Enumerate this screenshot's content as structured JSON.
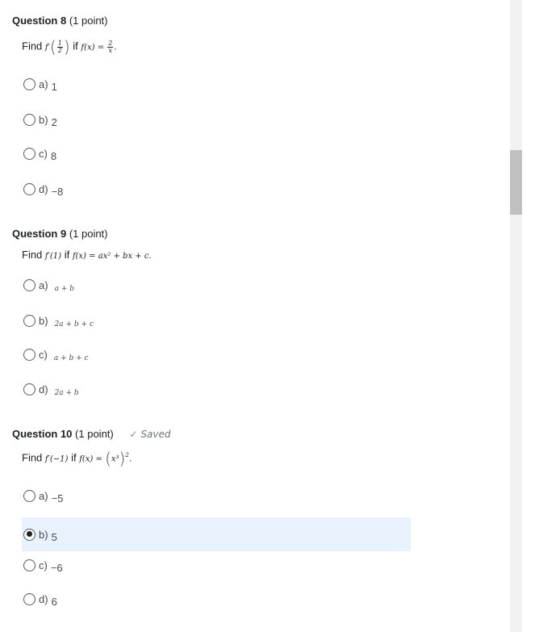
{
  "questions": [
    {
      "title": "Question 8",
      "points": "(1 point)",
      "prompt": {
        "find": "Find",
        "fprime": "f′",
        "frac_num": "1",
        "frac_den": "2",
        "if": "if",
        "fx": "f(x) = ",
        "rhs_num": "2",
        "rhs_den": "x",
        "end": "."
      },
      "options": [
        {
          "letter": "a)",
          "value": "1"
        },
        {
          "letter": "b)",
          "value": "2"
        },
        {
          "letter": "c)",
          "value": "8"
        },
        {
          "letter": "d)",
          "value": "−8"
        }
      ]
    },
    {
      "title": "Question 9",
      "points": "(1 point)",
      "prompt": {
        "find": "Find",
        "expr": "f′(1)",
        "if": "if",
        "fx": "f(x) = ax² + bx + c."
      },
      "options": [
        {
          "letter": "a)",
          "value": "a + b"
        },
        {
          "letter": "b)",
          "value": "2a + b + c"
        },
        {
          "letter": "c)",
          "value": "a + b + c"
        },
        {
          "letter": "d)",
          "value": "2a + b"
        }
      ]
    },
    {
      "title": "Question 10",
      "points": "(1 point)",
      "saved": "Saved",
      "prompt": {
        "find": "Find",
        "expr": "f′(−1)",
        "if": "if",
        "fx": "f(x) = ",
        "inner": "x³",
        "power": "2",
        "end": "."
      },
      "options": [
        {
          "letter": "a)",
          "value": "−5"
        },
        {
          "letter": "b)",
          "value": "5",
          "selected": true
        },
        {
          "letter": "c)",
          "value": "−6"
        },
        {
          "letter": "d)",
          "value": "6"
        }
      ]
    }
  ]
}
